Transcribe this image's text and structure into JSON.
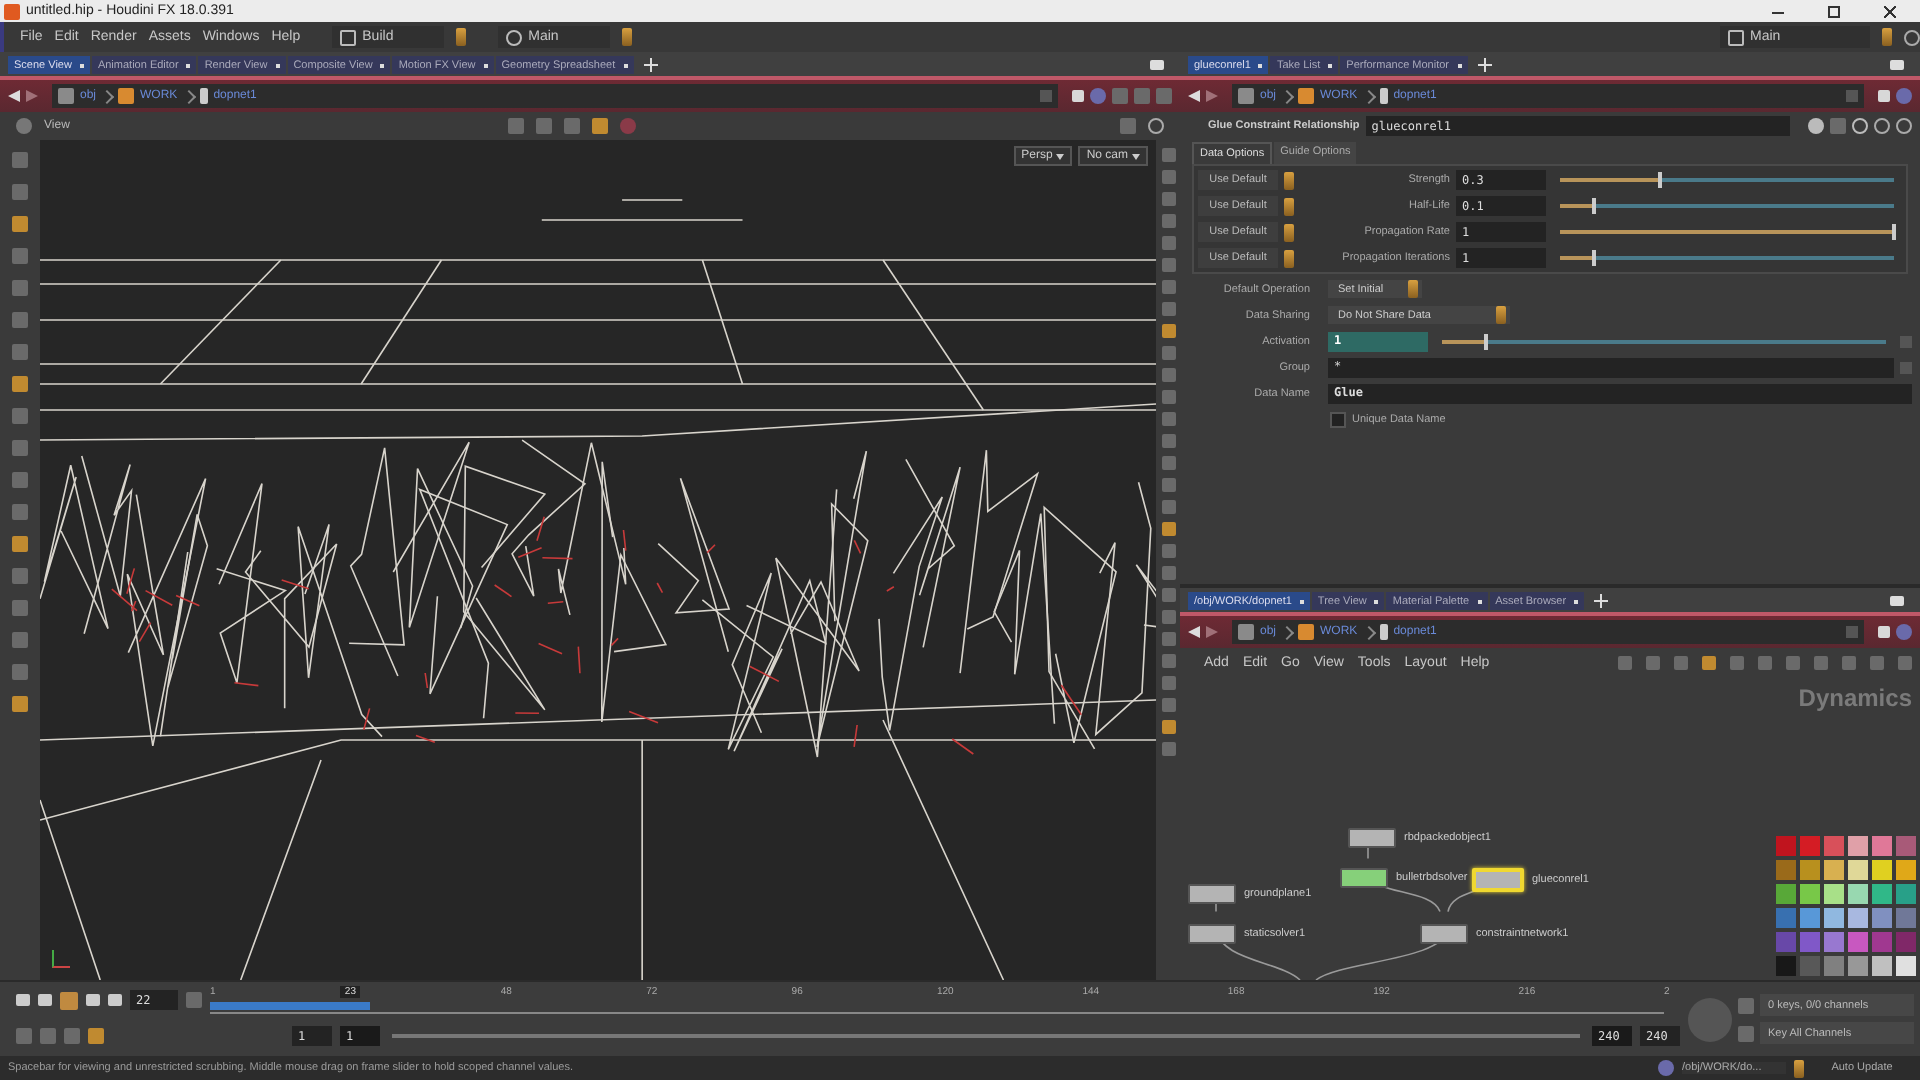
{
  "window": {
    "title": "untitled.hip - Houdini FX 18.0.391"
  },
  "menu": [
    "File",
    "Edit",
    "Render",
    "Assets",
    "Windows",
    "Help"
  ],
  "desktop": "Build",
  "main_menu": "Main",
  "right_desktop": "Main",
  "viewer_pane": {
    "tabs": [
      {
        "label": "Scene View",
        "selected": true
      },
      {
        "label": "Animation Editor",
        "selected": false
      },
      {
        "label": "Render View",
        "selected": false
      },
      {
        "label": "Composite View",
        "selected": false
      },
      {
        "label": "Motion FX View",
        "selected": false
      },
      {
        "label": "Geometry Spreadsheet",
        "selected": false
      }
    ],
    "path": [
      "obj",
      "WORK",
      "dopnet1"
    ],
    "view_label": "View",
    "perspective_menu": "Persp",
    "camera_menu": "No cam"
  },
  "param_pane": {
    "tabs": [
      {
        "label": "glueconrel1",
        "selected": true
      },
      {
        "label": "Take List",
        "selected": false
      },
      {
        "label": "Performance Monitor",
        "selected": false
      }
    ],
    "path": [
      "obj",
      "WORK",
      "dopnet1"
    ],
    "node_type": "Glue Constraint Relationship",
    "node_name": "glueconrel1",
    "subtabs": [
      {
        "label": "Data Options",
        "selected": true
      },
      {
        "label": "Guide Options",
        "selected": false
      }
    ],
    "slider_rows": [
      {
        "mode": "Use Default",
        "label": "Strength",
        "value": "0.3",
        "level": 0.3
      },
      {
        "mode": "Use Default",
        "label": "Half-Life",
        "value": "0.1",
        "level": 0.1
      },
      {
        "mode": "Use Default",
        "label": "Propagation Rate",
        "value": "1",
        "level": 1
      },
      {
        "mode": "Use Default",
        "label": "Propagation Iterations",
        "value": "1",
        "level": 0.1
      }
    ],
    "default_operation": {
      "label": "Default Operation",
      "value": "Set Initial"
    },
    "data_sharing": {
      "label": "Data Sharing",
      "value": "Do Not Share Data"
    },
    "activation": {
      "label": "Activation",
      "value": "1",
      "level": 0.1
    },
    "group": {
      "label": "Group",
      "value": "*"
    },
    "data_name": {
      "label": "Data Name",
      "value": "Glue"
    },
    "unique_data_name": {
      "label": "Unique Data Name",
      "checked": false
    }
  },
  "network_pane": {
    "tabs": [
      {
        "label": "/obj/WORK/dopnet1",
        "selected": true
      },
      {
        "label": "Tree View",
        "selected": false
      },
      {
        "label": "Material Palette",
        "selected": false
      },
      {
        "label": "Asset Browser",
        "selected": false
      }
    ],
    "path": [
      "obj",
      "WORK",
      "dopnet1"
    ],
    "menu": [
      "Add",
      "Edit",
      "Go",
      "View",
      "Tools",
      "Layout",
      "Help"
    ],
    "context_label": "Dynamics",
    "nodes": [
      {
        "name": "rbdpackedobject1",
        "selected": false,
        "color": "#b4b4b4"
      },
      {
        "name": "bulletrbdsolver",
        "selected": false,
        "color": "#86d07a"
      },
      {
        "name": "glueconrel1",
        "selected": true,
        "color": "#b4b4b4"
      },
      {
        "name": "groundplane1",
        "selected": false,
        "color": "#b4b4b4"
      },
      {
        "name": "staticsolver1",
        "selected": false,
        "color": "#b4b4b4"
      },
      {
        "name": "constraintnetwork1",
        "selected": false,
        "color": "#b4b4b4"
      }
    ],
    "palette": [
      {
        "color": "#c0141e"
      },
      {
        "color": "#d41c24"
      },
      {
        "color": "#d8505a"
      },
      {
        "color": "#e0a0a8"
      },
      {
        "color": "#e07898"
      },
      {
        "color": "#a85a78"
      },
      {
        "color": "#9a6a1a"
      },
      {
        "color": "#b8901e"
      },
      {
        "color": "#d8b050"
      },
      {
        "color": "#e0d898"
      },
      {
        "color": "#e0d020"
      },
      {
        "color": "#e0a818"
      },
      {
        "color": "#58a838"
      },
      {
        "color": "#78c848"
      },
      {
        "color": "#a8e088"
      },
      {
        "color": "#98d8b0"
      },
      {
        "color": "#30b888"
      },
      {
        "color": "#28a088"
      },
      {
        "color": "#3870b0"
      },
      {
        "color": "#5898d8"
      },
      {
        "color": "#90b8e0"
      },
      {
        "color": "#a8b8e0"
      },
      {
        "color": "#8090c0"
      },
      {
        "color": "#707898"
      },
      {
        "color": "#6848a8"
      },
      {
        "color": "#8058c8"
      },
      {
        "color": "#9878d0"
      },
      {
        "color": "#c858c0"
      },
      {
        "color": "#a03890"
      },
      {
        "color": "#802868"
      },
      {
        "color": "#181818"
      },
      {
        "color": "#585858"
      },
      {
        "color": "#808080"
      },
      {
        "color": "#989898"
      },
      {
        "color": "#c0c0c0"
      },
      {
        "color": "#e0e0e0"
      }
    ]
  },
  "timeline": {
    "frame": "22",
    "marker": "23",
    "level": 0.09,
    "ticks": [
      "1",
      "48",
      "72",
      "96",
      "120",
      "144",
      "168",
      "192",
      "216",
      "2"
    ],
    "range_start": [
      "1",
      "1"
    ],
    "range_end": [
      "240",
      "240"
    ],
    "keys_info": "0 keys, 0/0 channels",
    "key_mode": "Key All Channels"
  },
  "status_bar": {
    "message": "Spacebar for viewing and unrestricted scrubbing. Middle mouse drag on frame slider to hold scoped channel values.",
    "path": "/obj/WORK/do...",
    "update_mode": "Auto Update"
  }
}
